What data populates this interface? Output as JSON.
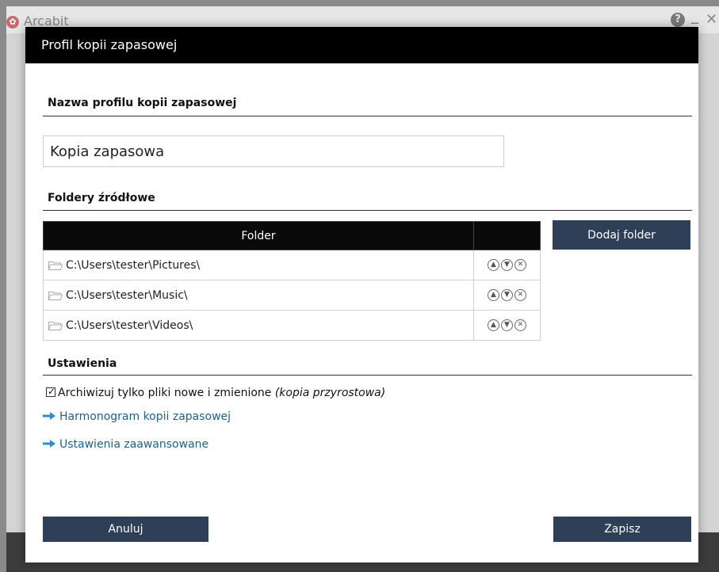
{
  "background": {
    "app_title": "Arcabit"
  },
  "dialog": {
    "title": "Profil kopii zapasowej",
    "name_section": {
      "heading": "Nazwa profilu kopii zapasowej",
      "value": "Kopia zapasowa"
    },
    "folders_section": {
      "heading": "Foldery źródłowe",
      "column_folder": "Folder",
      "rows": [
        {
          "path": "C:\\Users\\tester\\Pictures\\"
        },
        {
          "path": "C:\\Users\\tester\\Music\\"
        },
        {
          "path": "C:\\Users\\tester\\Videos\\"
        }
      ],
      "add_button": "Dodaj folder"
    },
    "settings_section": {
      "heading": "Ustawienia",
      "incremental_label": "Archiwizuj tylko pliki nowe i zmienione",
      "incremental_note": "(kopia przyrostowa)",
      "incremental_checked": true,
      "schedule_link": "Harmonogram kopii zapasowej",
      "advanced_link": "Ustawienia zaawansowane"
    },
    "footer": {
      "cancel": "Anuluj",
      "save": "Zapisz"
    }
  },
  "colors": {
    "header_bg": "#000000",
    "button_bg": "#2f3f57",
    "link": "#1f5f8a",
    "arrow": "#2a8fd0"
  }
}
